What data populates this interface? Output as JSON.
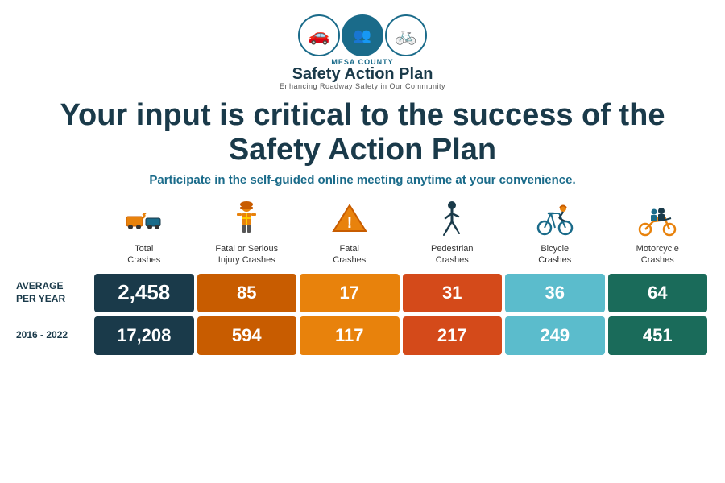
{
  "logo": {
    "small_text": "Mesa County",
    "title": "Safety Action Plan",
    "subtitle": "Enhancing Roadway Safety in Our Community",
    "icon1": "🚗",
    "icon2": "👥",
    "icon3": "🚲"
  },
  "headline": "Your input is critical to the success of the Safety Action Plan",
  "subheadline": "Participate in the self-guided online meeting anytime at your convenience.",
  "columns": [
    {
      "id": "total",
      "label": "Total\nCrashes",
      "icon": "🚗💥",
      "color_avg": "cell-dark-navy",
      "color_total": "cell-dark-navy"
    },
    {
      "id": "fatal-serious",
      "label": "Fatal or Serious\nInjury Crashes",
      "icon": "🦺",
      "color_avg": "cell-dark-orange",
      "color_total": "cell-dark-orange"
    },
    {
      "id": "fatal",
      "label": "Fatal\nCrashes",
      "icon": "⚠️",
      "color_avg": "cell-orange",
      "color_total": "cell-orange"
    },
    {
      "id": "pedestrian",
      "label": "Pedestrian\nCrashes",
      "icon": "🚶",
      "color_avg": "cell-red-orange",
      "color_total": "cell-red-orange"
    },
    {
      "id": "bicycle",
      "label": "Bicycle\nCrashes",
      "icon": "🚲",
      "color_avg": "cell-light-blue",
      "color_total": "cell-light-blue"
    },
    {
      "id": "motorcycle",
      "label": "Motorcycle\nCrashes",
      "icon": "🛵",
      "color_avg": "cell-dark-teal",
      "color_total": "cell-dark-teal"
    }
  ],
  "rows": [
    {
      "label": "AVERAGE\nPER YEAR",
      "values": [
        "2,458",
        "85",
        "17",
        "31",
        "36",
        "64"
      ]
    },
    {
      "label": "2016 - 2022",
      "values": [
        "17,208",
        "594",
        "117",
        "217",
        "249",
        "451"
      ]
    }
  ]
}
